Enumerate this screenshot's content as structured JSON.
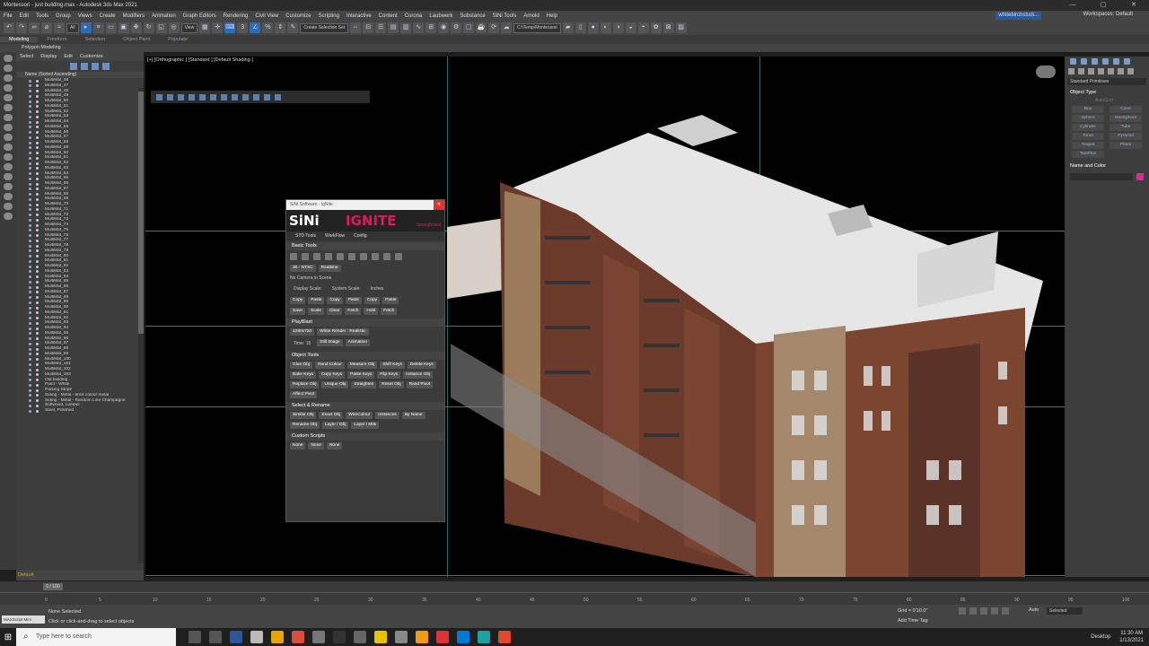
{
  "window": {
    "title": "Montessori - just building.max - Autodesk 3ds Max 2021",
    "min": "—",
    "max": "▢",
    "close": "✕"
  },
  "menu": [
    "File",
    "Edit",
    "Tools",
    "Group",
    "Views",
    "Create",
    "Modifiers",
    "Animation",
    "Graph Editors",
    "Rendering",
    "Civil View",
    "Customize",
    "Scripting",
    "Interactive",
    "Content",
    "Corona",
    "Laubwerk",
    "Substance",
    "SiNi Tools",
    "Arnold",
    "Help"
  ],
  "user": "whitebirchstudi...",
  "workspace": "Workspaces: Default",
  "toolbar": {
    "filter": "All",
    "view": "View",
    "selset": "Create Selection Set",
    "path": "C:\\Temp\\Montessori"
  },
  "ribbon": {
    "tabs": [
      "Modeling",
      "Freeform",
      "Selection",
      "Object Paint",
      "Populate"
    ],
    "active": "Modeling",
    "sub": "Polygon Modeling"
  },
  "scene": {
    "menu": [
      "Select",
      "Display",
      "Edit",
      "Customize"
    ],
    "header": "Name (Sorted Ascending)",
    "items": [
      "MultiMat_46",
      "MultiMat_47",
      "MultiMat_48",
      "MultiMat_49",
      "MultiMat_50",
      "MultiMat_51",
      "MultiMat_52",
      "MultiMat_53",
      "MultiMat_54",
      "MultiMat_55",
      "MultiMat_56",
      "MultiMat_57",
      "MultiMat_58",
      "MultiMat_59",
      "MultiMat_60",
      "MultiMat_61",
      "MultiMat_62",
      "MultiMat_63",
      "MultiMat_64",
      "MultiMat_65",
      "MultiMat_66",
      "MultiMat_67",
      "MultiMat_68",
      "MultiMat_69",
      "MultiMat_70",
      "MultiMat_71",
      "MultiMat_72",
      "MultiMat_73",
      "MultiMat_74",
      "MultiMat_75",
      "MultiMat_76",
      "MultiMat_77",
      "MultiMat_78",
      "MultiMat_79",
      "MultiMat_80",
      "MultiMat_81",
      "MultiMat_82",
      "MultiMat_83",
      "MultiMat_84",
      "MultiMat_85",
      "MultiMat_86",
      "MultiMat_87",
      "MultiMat_88",
      "MultiMat_89",
      "MultiMat_90",
      "MultiMat_91",
      "MultiMat_92",
      "MultiMat_93",
      "MultiMat_94",
      "MultiMat_95",
      "MultiMat_96",
      "MultiMat_97",
      "MultiMat_98",
      "MultiMat_99",
      "MultiMat_100",
      "MultiMat_101",
      "MultiMat_102",
      "MultiMat_103",
      "Old building",
      "Paint - White",
      "Parking Stripe",
      "Siding - Metal - brick colour metal",
      "Siding - Metal - Random Line Champagne",
      "Softwood, Lumber",
      "Steel, Polished"
    ],
    "layer": "Default"
  },
  "viewport": {
    "label": "[+] [Orthographic ] [Standard ] [Default Shading ]"
  },
  "sini": {
    "title": "SiNi Software - IgNite",
    "logo": "SiNi",
    "brand": "IGNITE",
    "sub": "Spoegboard",
    "tabs": [
      "STD Tools",
      "WorkFlow",
      "Config"
    ],
    "basic": "Basic Tools",
    "ntsc": "30 - NTSC",
    "realtime": "Realtime",
    "noCam": "No Camera in Scene",
    "dispScale": "Display Scale:",
    "sysScale": "System Scale:",
    "sysUnit": "Inches",
    "row1": [
      "Copy",
      "Paste",
      "Copy",
      "Paste",
      "Copy",
      "Paste"
    ],
    "row2": [
      "Save",
      "Scale",
      "Clear",
      "Fetch",
      "Hold",
      "Fetch"
    ],
    "playblast": "PlayBlast",
    "res": "1280x720",
    "wr": "White Render : Realistic",
    "time": "Time: 15",
    "still": "Still Image",
    "anim": "Animation",
    "objtools": "Object Tools",
    "ot": [
      "Glue Obj",
      "Rand Colour",
      "Measure Obj",
      "Shift Keys",
      "Delete Keys",
      "Bake Keys",
      "Copy Keys",
      "Paste Keys",
      "Flip Keys",
      "Instance Obj",
      "Replace Obj",
      "Unique Obj",
      "Straighten",
      "Reset Obj",
      "Rand Pivot",
      "Affect Pivot"
    ],
    "sr": "Select & Rename",
    "srb": [
      "Similar Obj",
      "Exact Obj",
      "WireColour",
      "Instances",
      "By Name",
      "Rename Obj",
      "Layer / Obj",
      "Layer / Mtls"
    ],
    "cs": "Custom Scripts",
    "none": "None"
  },
  "cmd": {
    "dropdown": "Standard Primitives",
    "objtype": "Object Type",
    "autogrid": "AutoGrid",
    "objects": [
      "Box",
      "Cone",
      "Sphere",
      "GeoSphere",
      "Cylinder",
      "Tube",
      "Torus",
      "Pyramid",
      "Teapot",
      "Plane",
      "TextPlus"
    ],
    "namecolor": "Name and Color"
  },
  "time": {
    "slider": "0 / 100",
    "ticks": [
      "0",
      "5",
      "10",
      "15",
      "20",
      "25",
      "30",
      "35",
      "40",
      "45",
      "50",
      "55",
      "60",
      "65",
      "70",
      "75",
      "80",
      "85",
      "90",
      "95",
      "100"
    ]
  },
  "status": {
    "maxscript": "MAXScript Mini",
    "selected": "None Selected",
    "hint": "Click or click-and-drag to select objects",
    "grid": "Grid = 0'10.0\"",
    "addtime": "Add Time Tag",
    "auto": "Auto",
    "selected2": "Selected",
    "setk": "Set K.",
    "filters": "Filters..."
  },
  "taskbar": {
    "search": "Type here to search",
    "desktop": "Desktop",
    "time": "11:30 AM",
    "date": "1/13/2021"
  },
  "colors": {
    "accent": "#2d6cb4",
    "ignite": "#e0195c",
    "grid": "#8a6a00"
  }
}
